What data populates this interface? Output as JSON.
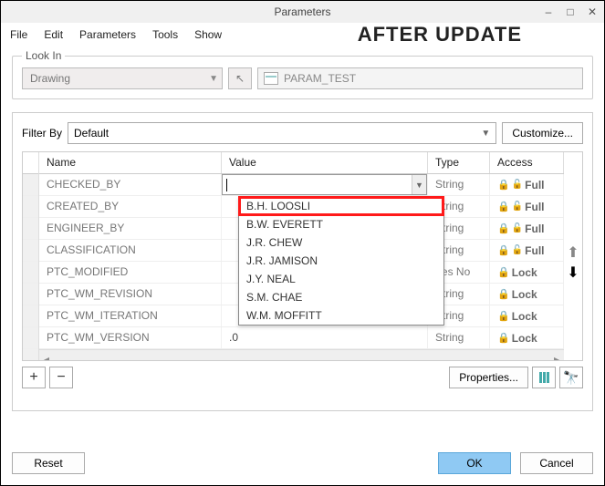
{
  "window": {
    "title": "Parameters"
  },
  "menu": {
    "file": "File",
    "edit": "Edit",
    "parameters": "Parameters",
    "tools": "Tools",
    "show": "Show",
    "banner": "AFTER UPDATE"
  },
  "lookin": {
    "label": "Look In",
    "drawing": "Drawing",
    "param": "PARAM_TEST"
  },
  "filter": {
    "label": "Filter By",
    "default": "Default",
    "customize": "Customize..."
  },
  "columns": {
    "name": "Name",
    "value": "Value",
    "type": "Type",
    "access": "Access"
  },
  "rows": [
    {
      "name": "CHECKED_BY",
      "value": "",
      "type": "String",
      "access": "Full",
      "active": true
    },
    {
      "name": "CREATED_BY",
      "value": "",
      "type": "String",
      "access": "Full"
    },
    {
      "name": "ENGINEER_BY",
      "value": "",
      "type": "String",
      "access": "Full"
    },
    {
      "name": "CLASSIFICATION",
      "value": "",
      "type": "String",
      "access": "Full"
    },
    {
      "name": "PTC_MODIFIED",
      "value": "",
      "type": "Yes No",
      "access": "Lock"
    },
    {
      "name": "PTC_WM_REVISION",
      "value": "",
      "type": "String",
      "access": "Lock"
    },
    {
      "name": "PTC_WM_ITERATION",
      "value": "",
      "type": "String",
      "access": "Lock"
    },
    {
      "name": "PTC_WM_VERSION",
      "value": ".0",
      "type": "String",
      "access": "Lock"
    }
  ],
  "dropdown": [
    "B.H. LOOSLI",
    "B.W. EVERETT",
    "J.R. CHEW",
    "J.R. JAMISON",
    "J.Y. NEAL",
    "S.M. CHAE",
    "W.M. MOFFITT"
  ],
  "under": {
    "properties": "Properties..."
  },
  "footer": {
    "reset": "Reset",
    "ok": "OK",
    "cancel": "Cancel"
  }
}
